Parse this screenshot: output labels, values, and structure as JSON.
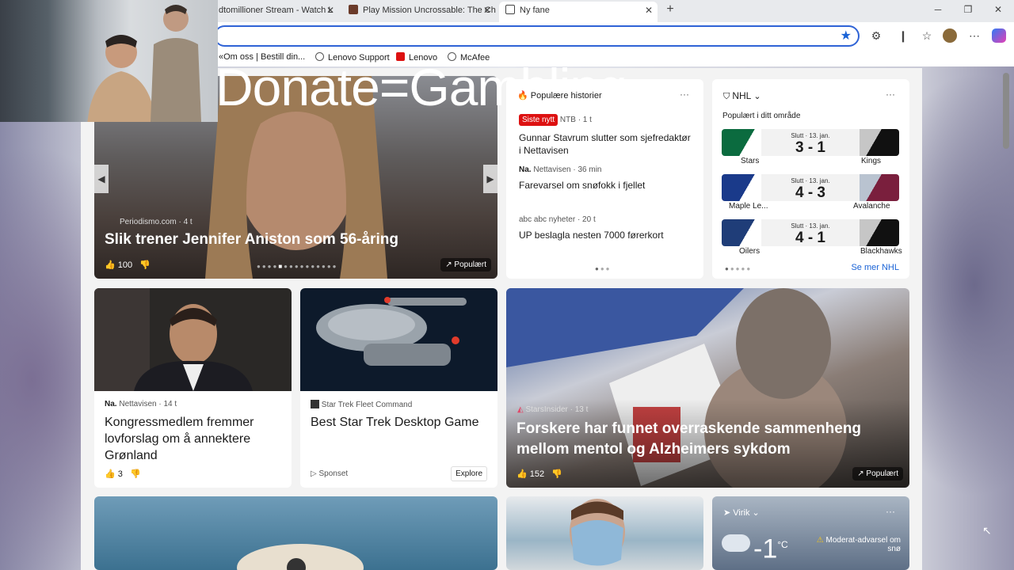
{
  "tabs": [
    {
      "label": "dtomillioner Stream - Watch L"
    },
    {
      "label": "Play Mission Uncrossable: The Ch"
    },
    {
      "label": "Ny fane"
    }
  ],
  "favorites": [
    {
      "label": "«Om oss | Bestill din..."
    },
    {
      "label": "Lenovo Support"
    },
    {
      "label": "Lenovo"
    },
    {
      "label": "McAfee"
    }
  ],
  "overlay_text": "Donate=Gambling",
  "hero": {
    "source": "Periodismo.com · 4 t",
    "title": "Slik trener Jennifer Aniston som 56-åring",
    "likes": "100",
    "badge": "Populært"
  },
  "news": {
    "header": "Populære historier",
    "items": [
      {
        "tag": "Siste nytt",
        "source": "NTB · 1 t",
        "title": "Gunnar Stavrum slutter som sjefredaktør i Nettavisen"
      },
      {
        "logo": "Na.",
        "source": "Nettavisen · 36 min",
        "title": "Farevarsel om snøfokk i fjellet"
      },
      {
        "logo": "abc",
        "source": "abc nyheter · 20 t",
        "title": "UP beslagla nesten 7000 førerkort"
      }
    ]
  },
  "nhl": {
    "title": "NHL",
    "subtitle": "Populært i ditt område",
    "more": "Se mer NHL",
    "games": [
      {
        "status": "Slutt · 13. jan.",
        "score": "3 - 1",
        "home": "Stars",
        "away": "Kings",
        "home_color": "#0b6b3f",
        "away_color": "#111111"
      },
      {
        "status": "Slutt · 13. jan.",
        "score": "4 - 3",
        "home": "Maple Le...",
        "away": "Avalanche",
        "home_color": "#1a3a8a",
        "away_color": "#7a1f3d"
      },
      {
        "status": "Slutt · 13. jan.",
        "score": "4 - 1",
        "home": "Oilers",
        "away": "Blackhawks",
        "home_color": "#1f3d78",
        "away_color": "#111111"
      }
    ]
  },
  "card1": {
    "logo": "Na.",
    "source": "Nettavisen · 14 t",
    "title": "Kongressmedlem fremmer lovforslag om å annektere Grønland",
    "likes": "3"
  },
  "card2": {
    "source": "Star Trek Fleet Command",
    "title": "Best Star Trek Desktop Game",
    "sponsored": "Sponset",
    "cta": "Explore"
  },
  "big": {
    "source": "StarsInsider · 13 t",
    "title": "Forskere har funnet overraskende sammenheng mellom mentol og Alzheimers sykdom",
    "likes": "152",
    "badge": "Populært"
  },
  "weather": {
    "location": "Virik",
    "temp": "-1",
    "unit": "°C",
    "alert": "Moderat-advarsel om snø"
  }
}
